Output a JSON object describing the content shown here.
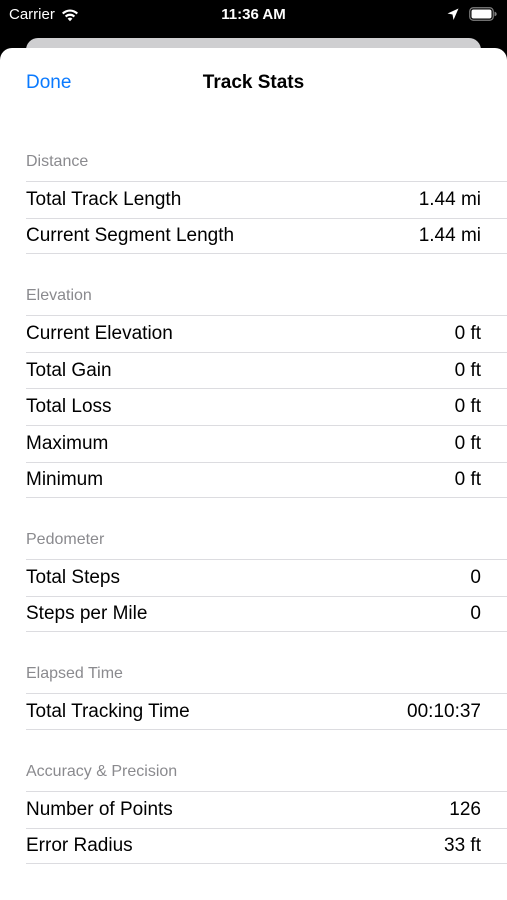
{
  "status_bar": {
    "carrier": "Carrier",
    "time": "11:36 AM"
  },
  "nav": {
    "done_label": "Done",
    "title": "Track Stats"
  },
  "sections": [
    {
      "title": "Distance",
      "rows": [
        {
          "label": "Total Track Length",
          "value": "1.44 mi"
        },
        {
          "label": "Current Segment Length",
          "value": "1.44 mi"
        }
      ]
    },
    {
      "title": "Elevation",
      "rows": [
        {
          "label": "Current Elevation",
          "value": "0 ft"
        },
        {
          "label": "Total Gain",
          "value": "0 ft"
        },
        {
          "label": "Total Loss",
          "value": "0 ft"
        },
        {
          "label": "Maximum",
          "value": "0 ft"
        },
        {
          "label": "Minimum",
          "value": "0 ft"
        }
      ]
    },
    {
      "title": "Pedometer",
      "rows": [
        {
          "label": "Total Steps",
          "value": "0"
        },
        {
          "label": "Steps per Mile",
          "value": "0"
        }
      ]
    },
    {
      "title": "Elapsed Time",
      "rows": [
        {
          "label": "Total Tracking Time",
          "value": "00:10:37"
        }
      ]
    },
    {
      "title": "Accuracy & Precision",
      "rows": [
        {
          "label": "Number of Points",
          "value": "126"
        },
        {
          "label": "Error Radius",
          "value": "33 ft"
        }
      ]
    }
  ],
  "colors": {
    "accent": "#0a7aff",
    "section_header": "#8a8a8e",
    "separator": "#dcdce0"
  }
}
